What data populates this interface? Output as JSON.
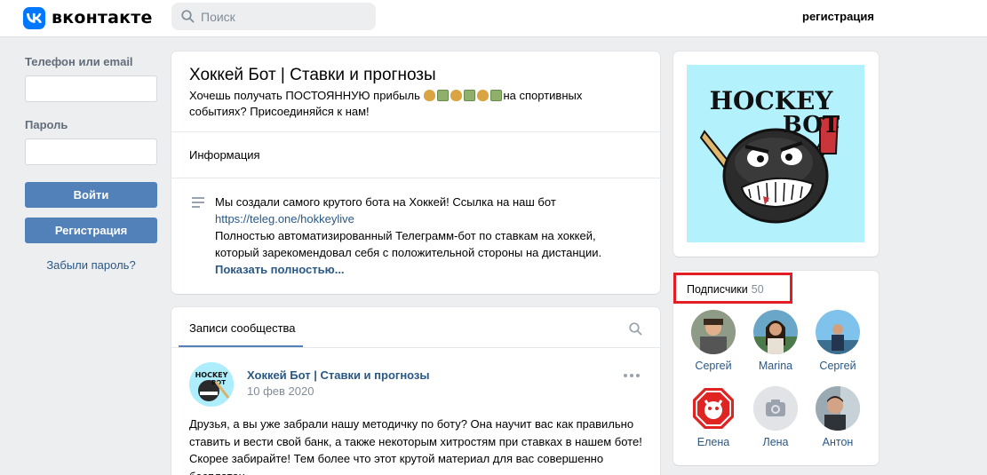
{
  "header": {
    "logo_text": "вконтакте",
    "search_placeholder": "Поиск",
    "register_link": "регистрация"
  },
  "login": {
    "phone_label": "Телефон или email",
    "password_label": "Пароль",
    "login_button": "Войти",
    "register_button": "Регистрация",
    "forgot_link": "Забыли пароль?"
  },
  "group": {
    "title": "Хоккей Бот | Ставки и прогнозы",
    "status_part1": "Хочешь получать ПОСТОЯННУЮ прибыль",
    "status_part2": "на спортивных событиях? Присоединяйся к нам!",
    "info_tab": "Информация",
    "desc_line1": "Мы создали самого крутого бота на Хоккей! Ссылка на наш бот",
    "desc_link": "https://teleg.one/hokkeylive",
    "desc_line2": "Полностью автоматизированный Телеграмм-бот по ставкам на хоккей,",
    "desc_line3": "который зарекомендовал себя с положительной стороны на дистанции.",
    "show_more": "Показать полностью..."
  },
  "posts": {
    "tab_label": "Записи сообщества",
    "author": "Хоккей Бот | Ставки и прогнозы",
    "date": "10 фев 2020",
    "text": "Друзья, а вы уже забрали нашу методичку по боту? Она научит вас как правильно ставить и вести свой банк, а также некоторым хитростям при ставках в нашем боте! Скорее забирайте! Тем более что этот крутой материал для вас совершенно бесплатен"
  },
  "cover": {
    "line1": "HOCKEY",
    "line2": "BOT",
    "thumb_line1": "HOCKEY",
    "thumb_line2": "BOT"
  },
  "subscribers": {
    "title": "Подписчики",
    "count": "50",
    "items": [
      {
        "name": "Сергей"
      },
      {
        "name": "Marina"
      },
      {
        "name": "Сергей"
      },
      {
        "name": "Елена"
      },
      {
        "name": "Лена"
      },
      {
        "name": "Антон"
      }
    ]
  },
  "colors": {
    "accent": "#5181b8",
    "link": "#2a5885",
    "vk_blue": "#0077ff",
    "highlight": "#e21d23",
    "background": "#edeef0"
  },
  "icons": [
    "vk-logo-icon",
    "search-icon",
    "description-icon",
    "more-dots-icon",
    "camera-icon",
    "gift-icon"
  ]
}
